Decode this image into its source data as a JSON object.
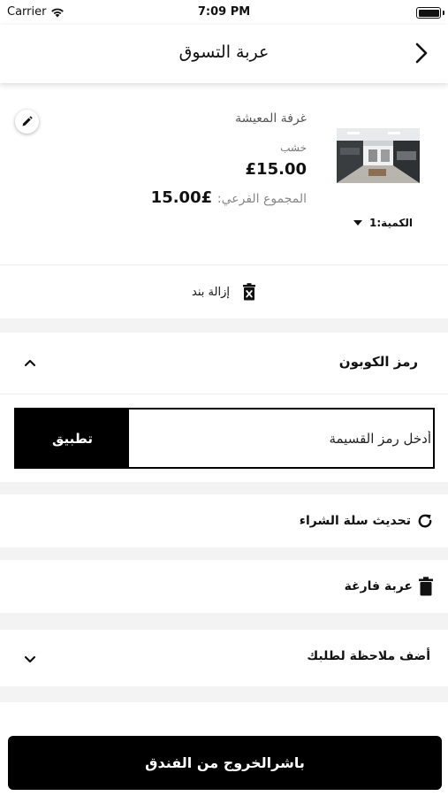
{
  "status_bar": {
    "carrier": "Carrier",
    "time": "7:09 PM",
    "battery_level": 1.0
  },
  "nav": {
    "title": "عربة التسوق",
    "back_icon": "chevron-right-icon"
  },
  "cart_item": {
    "name": "غرفة المعيشة",
    "option": "خشب",
    "price": "£15.00",
    "subtotal_label": "المجموع الفرعي:",
    "subtotal_value": "£15.00",
    "quantity_label": "الكمية:1",
    "edit_icon": "pencil-icon",
    "image_icon": "room-photo"
  },
  "remove_item": {
    "label": "إزالة بند",
    "icon": "trash-x-icon"
  },
  "coupon": {
    "title": "رمز الكوبون",
    "placeholder": "أدخل رمز القسيمة",
    "apply_label": "تطبيق",
    "expanded": true
  },
  "actions": {
    "update_cart": "تحديث سلة الشراء",
    "empty_cart": "عربة فارغة"
  },
  "order_note": {
    "title": "أضف ملاحظة لطلبك",
    "expanded": false
  },
  "checkout": {
    "label": "باشرالخروج من الفندق"
  },
  "colors": {
    "primary": "#000000",
    "divider": "#f3f3f3",
    "muted": "#888888"
  }
}
